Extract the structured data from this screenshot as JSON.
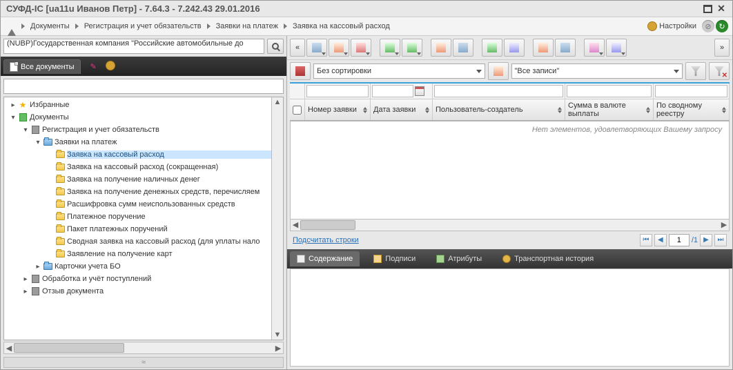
{
  "title": "СУФД-IC [ua11u Иванов Петр] - 7.64.3 - 7.242.43 29.01.2016",
  "breadcrumbs": {
    "b1": "Документы",
    "b2": "Регистрация и учет обязательств",
    "b3": "Заявки на платеж",
    "b4": "Заявка на кассовый расход"
  },
  "settings_label": "Настройки",
  "org": {
    "value": "(NUBP)Государственная компания \"Российские автомобильные до"
  },
  "tab_all_docs": "Все документы",
  "sort": {
    "no_sort": "Без сортировки",
    "all_records": "\"Все записи\""
  },
  "tree": {
    "fav": "Избранные",
    "docs": "Документы",
    "reg": "Регистрация и учет обязательств",
    "zayp": "Заявки на платеж",
    "n1": "Заявка на кассовый расход",
    "n2": "Заявка на кассовый расход (сокращенная)",
    "n3": "Заявка на получение наличных денег",
    "n4": "Заявка на получение денежных средств, перечисляем",
    "n5": "Расшифровка сумм неиспользованных средств",
    "n6": "Платежное поручение",
    "n7": "Пакет платежных поручений",
    "n8": "Сводная заявка на кассовый расход (для уплаты нало",
    "n9": "Заявление на получение карт",
    "kbo": "Карточки учета БО",
    "obr": "Обработка и учёт поступлений",
    "otz": "Отзыв документа"
  },
  "headers": {
    "num": "Номер заявки",
    "date": "Дата заявки",
    "user": "Пользователь-создатель",
    "sum": "Сумма в валюте выплаты",
    "reg": "По сводному реестру"
  },
  "empty": "Нет элементов, удовлетворяющих Вашему запросу",
  "count_link": "Подсчитать строки",
  "pager": {
    "page": "1",
    "total": "/1"
  },
  "bottom_tabs": {
    "content": "Содержание",
    "sign": "Подписи",
    "attr": "Атрибуты",
    "trans": "Транспортная история"
  }
}
